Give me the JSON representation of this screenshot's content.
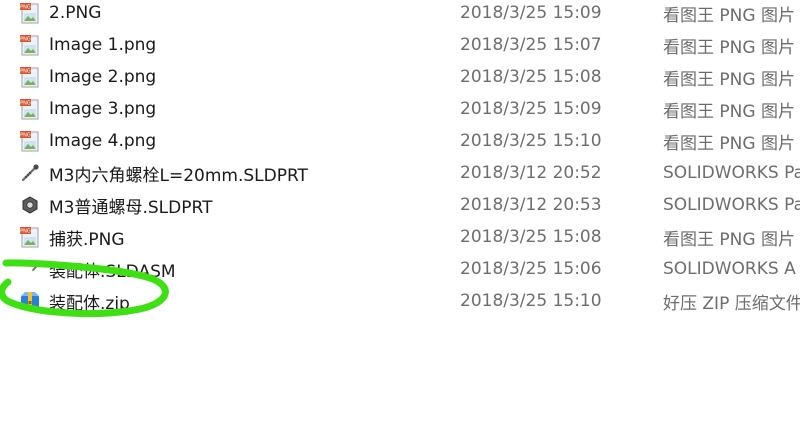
{
  "files": [
    {
      "name": "2.PNG",
      "date": "2018/3/25 15:09",
      "type": "看图王 PNG 图片",
      "icon": "png-image-icon"
    },
    {
      "name": "Image 1.png",
      "date": "2018/3/25 15:07",
      "type": "看图王 PNG 图片",
      "icon": "png-image-icon"
    },
    {
      "name": "Image 2.png",
      "date": "2018/3/25 15:08",
      "type": "看图王 PNG 图片",
      "icon": "png-image-icon"
    },
    {
      "name": "Image 3.png",
      "date": "2018/3/25 15:09",
      "type": "看图王 PNG 图片",
      "icon": "png-image-icon"
    },
    {
      "name": "Image 4.png",
      "date": "2018/3/25 15:10",
      "type": "看图王 PNG 图片",
      "icon": "png-image-icon"
    },
    {
      "name": "M3内六角螺栓L=20mm.SLDPRT",
      "date": "2018/3/12 20:52",
      "type": "SOLIDWORKS Pa",
      "icon": "bolt-part-icon"
    },
    {
      "name": "M3普通螺母.SLDPRT",
      "date": "2018/3/12 20:53",
      "type": "SOLIDWORKS Pa",
      "icon": "nut-part-icon"
    },
    {
      "name": "捕获.PNG",
      "date": "2018/3/25 15:08",
      "type": "看图王 PNG 图片",
      "icon": "png-image-icon"
    },
    {
      "name": "装配体.SLDASM",
      "date": "2018/3/25 15:06",
      "type": "SOLIDWORKS A",
      "icon": "assembly-icon"
    },
    {
      "name": "装配体.zip",
      "date": "2018/3/25 15:10",
      "type": "好压 ZIP 压缩文件",
      "icon": "zip-archive-icon"
    }
  ],
  "annotation_color": "#3ee014",
  "icon_colors": {
    "png_badge": "#d9542b",
    "png_page": "#e9eef5",
    "zip_blue": "#2a7fd6",
    "zip_band": "#f2c232"
  }
}
